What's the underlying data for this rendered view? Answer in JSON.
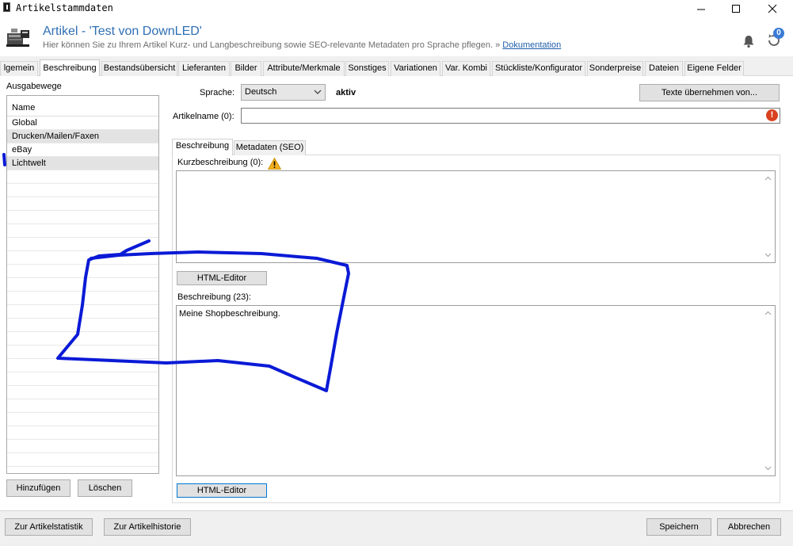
{
  "window": {
    "title": "Artikelstammdaten",
    "controls": [
      "minimize",
      "maximize",
      "close"
    ]
  },
  "header": {
    "title": "Artikel - 'Test von DownLED'",
    "subtitle": "Hier können Sie zu Ihrem Artikel Kurz- und Langbeschreibung sowie SEO-relevante Metadaten pro Sprache pflegen.",
    "link_prefix": "»",
    "link_text": "Dokumentation",
    "notification_badge": "0",
    "accent_color": "#2f6fb5"
  },
  "tabs": [
    "lgemein",
    "Beschreibung",
    "Bestandsübersicht",
    "Lieferanten",
    "Bilder",
    "Attribute/Merkmale",
    "Sonstiges",
    "Variationen",
    "Var. Kombi",
    "Stückliste/Konfigurator",
    "Sonderpreise",
    "Dateien",
    "Eigene Felder"
  ],
  "active_tab": "Beschreibung",
  "left_panel": {
    "section_label": "Ausgabewege",
    "column_header": "Name",
    "channels": [
      "Global",
      "Drucken/Mailen/Faxen",
      "eBay",
      "Lichtwelt"
    ],
    "selected_channels": [
      "Drucken/Mailen/Faxen",
      "Lichtwelt"
    ],
    "add_button": "Hinzufügen",
    "delete_button": "Löschen"
  },
  "editor": {
    "language_label": "Sprache:",
    "language_value": "Deutsch",
    "status": "aktiv",
    "copy_texts_button": "Texte übernehmen von...",
    "article_name_label": "Artikelname (0):",
    "article_name_value": "",
    "inner_tabs": [
      "Beschreibung",
      "Metadaten (SEO)"
    ],
    "active_inner_tab": "Beschreibung",
    "short_desc_label": "Kurzbeschreibung (0):",
    "short_desc_value": "",
    "html_editor_button_1": "HTML-Editor",
    "desc_label": "Beschreibung (23):",
    "desc_value": "Meine Shopbeschreibung.",
    "html_editor_button_2": "HTML-Editor"
  },
  "footer": {
    "stats_button": "Zur Artikelstatistik",
    "history_button": "Zur Artikelhistorie",
    "save_button": "Speichern",
    "cancel_button": "Abbrechen"
  },
  "annotation": {
    "marker_color": "#0a1ad6"
  }
}
